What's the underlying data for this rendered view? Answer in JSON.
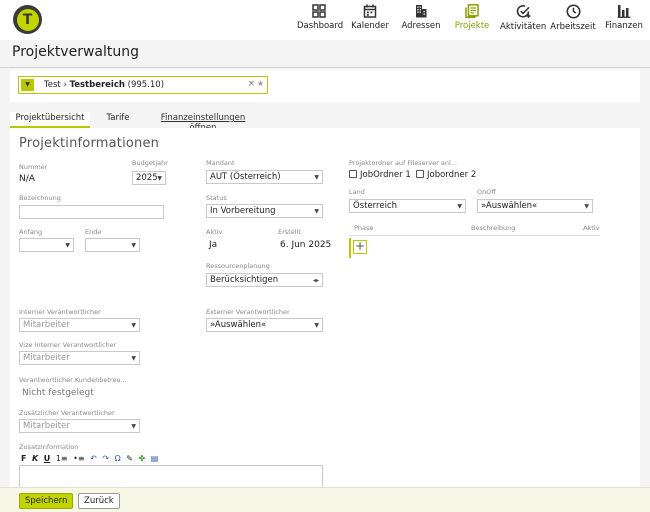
{
  "app": {
    "logo_letter": "T",
    "accent_color": "#c2d400",
    "nav": [
      {
        "label": "Dashboard",
        "icon": "dashboard-icon"
      },
      {
        "label": "Kalender",
        "icon": "calendar-icon"
      },
      {
        "label": "Adressen",
        "icon": "building-icon"
      },
      {
        "label": "Projekte",
        "icon": "projects-icon",
        "active": true
      },
      {
        "label": "Aktivitäten",
        "icon": "activity-check-icon"
      },
      {
        "label": "Arbeitszeit",
        "icon": "clock-icon"
      },
      {
        "label": "Finanzen",
        "icon": "bar-chart-icon"
      }
    ]
  },
  "page": {
    "title": "Projektverwaltung"
  },
  "project_selector": {
    "parent": "Test",
    "separator": "›",
    "current": "Testbereich",
    "code": "(995.10)",
    "clear": "×",
    "star": "★"
  },
  "tabs": [
    {
      "label": "Projektübersicht",
      "active": true
    },
    {
      "label": "Tarife"
    },
    {
      "label": "Finanzeinstellungen öffnen",
      "link": true
    }
  ],
  "form": {
    "section_title": "Projektinformationen",
    "nummer_label": "Nummer",
    "nummer_value": "N/A",
    "budgetjahr_label": "Budgetjahr",
    "budgetjahr_value": "2025",
    "bezeichnung_label": "Bezeichnung",
    "anfang_label": "Anfang",
    "ende_label": "Ende",
    "mandant_label": "Mandant",
    "mandant_value": "AUT (Österreich)",
    "status_label": "Status",
    "status_value": "In Vorbereitung",
    "aktiv_label": "Aktiv",
    "aktiv_value": "Ja",
    "erstellt_label": "Erstellt",
    "erstellt_value": "6. Jun 2025",
    "ressourcen_label": "Ressourcenplanung",
    "ressourcen_value": "Berücksichtigen",
    "projektordner_label": "Projektordner auf Fileserver anl...",
    "jobordner1_label": "JobOrdner 1",
    "jobordner2_label": "Jobordner 2",
    "land_label": "Land",
    "land_value": "Österreich",
    "onoff_label": "OnOff",
    "onoff_value": "»Auswählen«",
    "phase_col": "Phase",
    "beschreibung_col": "Beschreibung",
    "aktiv_col": "Aktiv",
    "add_phase": "+",
    "interner_label": "Interner Verantwortlicher",
    "interner_value": "Mitarbeiter",
    "externer_label": "Externer Verantwortlicher",
    "externer_value": "»Auswählen«",
    "vize_label": "Vize Interner Verantwortlicher",
    "vize_value": "Mitarbeiter",
    "kunden_label": "Verantwortlicher Kundenbetreu...",
    "kunden_value": "Nicht festgelegt",
    "zusatz_label": "Zusätzlicher Verantwortlicher",
    "zusatz_value": "Mitarbeiter",
    "zusatzinfo_label": "Zusatzinformation"
  },
  "editor_toolbar": {
    "bold": "F",
    "italic": "K",
    "underline": "U",
    "ol": "1≡",
    "ul": "•≡",
    "undo": "↶",
    "redo": "↷",
    "omega": "Ω",
    "brush": "✎",
    "puzzle": "✤",
    "doc": "▤"
  },
  "footer": {
    "save_label": "Speichern",
    "back_label": "Zurück"
  }
}
